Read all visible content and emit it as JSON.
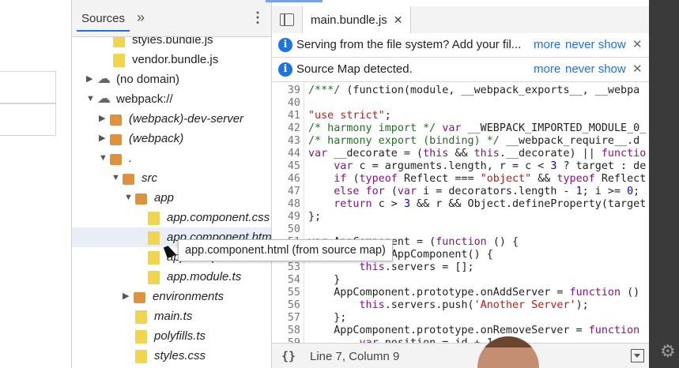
{
  "navigator": {
    "tab_label": "Sources",
    "more_tabs_icon": "»",
    "menu_icon": "⋮",
    "tree": [
      {
        "label": "styles.bundle.js",
        "kind": "file",
        "italic": false
      },
      {
        "label": "vendor.bundle.js",
        "kind": "file",
        "italic": false
      },
      {
        "label": "(no domain)",
        "kind": "cloud",
        "italic": false,
        "collapsed": true
      },
      {
        "label": "webpack://",
        "kind": "cloud",
        "italic": false,
        "collapsed": false
      },
      {
        "label": "(webpack)-dev-server",
        "kind": "folder",
        "italic": true,
        "collapsed": true
      },
      {
        "label": "(webpack)",
        "kind": "folder",
        "italic": true,
        "collapsed": true
      },
      {
        "label": ".",
        "kind": "folder",
        "italic": true,
        "collapsed": false
      },
      {
        "label": "src",
        "kind": "folder",
        "italic": true,
        "collapsed": false
      },
      {
        "label": "app",
        "kind": "folder",
        "italic": true,
        "collapsed": false
      },
      {
        "label": "app.component.css",
        "kind": "file",
        "italic": true
      },
      {
        "label": "app.component.html",
        "kind": "file",
        "italic": true,
        "selected": true
      },
      {
        "label": "app.component.ts",
        "kind": "file",
        "italic": true
      },
      {
        "label": "app.module.ts",
        "kind": "file",
        "italic": true
      },
      {
        "label": "environments",
        "kind": "folder",
        "italic": true,
        "collapsed": true
      },
      {
        "label": "main.ts",
        "kind": "file",
        "italic": true
      },
      {
        "label": "polyfills.ts",
        "kind": "file",
        "italic": true
      },
      {
        "label": "styles.css",
        "kind": "file",
        "italic": true
      }
    ]
  },
  "editor": {
    "open_tab": "main.bundle.js",
    "close_icon": "✕",
    "infobars": [
      {
        "message": "Serving from the file system? Add your fil...",
        "more": "more",
        "never_show": "never show",
        "close": "✕"
      },
      {
        "message": "Source Map detected.",
        "more": "more",
        "never_show": "never show",
        "close": "✕"
      }
    ],
    "code_lines": [
      {
        "n": "39",
        "parts": [
          [
            "cm",
            "/***/ "
          ],
          [
            "fn",
            "(function(module, __webpack_exports__, __webpa"
          ]
        ]
      },
      {
        "n": "40",
        "parts": []
      },
      {
        "n": "41",
        "parts": [
          [
            "st",
            "\"use strict\""
          ],
          [
            "fn",
            ";"
          ]
        ]
      },
      {
        "n": "42",
        "parts": [
          [
            "cm",
            "/* harmony import */ "
          ],
          [
            "kw",
            "var "
          ],
          [
            "fn",
            "__WEBPACK_IMPORTED_MODULE_0_"
          ]
        ]
      },
      {
        "n": "43",
        "parts": [
          [
            "cm",
            "/* harmony export (binding) */ "
          ],
          [
            "fn",
            "__webpack_require__.d"
          ]
        ]
      },
      {
        "n": "44",
        "parts": [
          [
            "kw",
            "var "
          ],
          [
            "fn",
            "__decorate = ("
          ],
          [
            "kw",
            "this "
          ],
          [
            "fn",
            "&& "
          ],
          [
            "kw",
            "this"
          ],
          [
            "fn",
            ".__decorate) || "
          ],
          [
            "kw",
            "functio"
          ]
        ]
      },
      {
        "n": "45",
        "parts": [
          [
            "fn",
            "    "
          ],
          [
            "kw",
            "var "
          ],
          [
            "fn",
            "c = arguments.length, r = c < "
          ],
          [
            "pl",
            "3"
          ],
          [
            "fn",
            " ? target : de"
          ]
        ]
      },
      {
        "n": "46",
        "parts": [
          [
            "fn",
            "    "
          ],
          [
            "kw",
            "if "
          ],
          [
            "fn",
            "("
          ],
          [
            "kw",
            "typeof "
          ],
          [
            "fn",
            "Reflect === "
          ],
          [
            "st",
            "\"object\""
          ],
          [
            "fn",
            " && "
          ],
          [
            "kw",
            "typeof "
          ],
          [
            "fn",
            "Reflect"
          ]
        ]
      },
      {
        "n": "47",
        "parts": [
          [
            "fn",
            "    "
          ],
          [
            "kw",
            "else for "
          ],
          [
            "fn",
            "("
          ],
          [
            "kw",
            "var "
          ],
          [
            "fn",
            "i = decorators.length - "
          ],
          [
            "pl",
            "1"
          ],
          [
            "fn",
            "; i >= "
          ],
          [
            "pl",
            "0"
          ],
          [
            "fn",
            ";"
          ]
        ]
      },
      {
        "n": "48",
        "parts": [
          [
            "fn",
            "    "
          ],
          [
            "kw",
            "return "
          ],
          [
            "fn",
            "c > "
          ],
          [
            "pl",
            "3"
          ],
          [
            "fn",
            " && r && Object.defineProperty(target"
          ]
        ]
      },
      {
        "n": "49",
        "parts": [
          [
            "fn",
            "};"
          ]
        ]
      },
      {
        "n": "50",
        "parts": []
      },
      {
        "n": "51",
        "parts": [
          [
            "fn",
            "var AppComponent = ("
          ],
          [
            "kw",
            "function "
          ],
          [
            "fn",
            "() {"
          ]
        ]
      },
      {
        "n": "52",
        "parts": [
          [
            "fn",
            "    "
          ],
          [
            "kw",
            "function "
          ],
          [
            "fn",
            "AppComponent() {"
          ]
        ]
      },
      {
        "n": "53",
        "parts": [
          [
            "fn",
            "        "
          ],
          [
            "kw",
            "this"
          ],
          [
            "fn",
            ".servers = [];"
          ]
        ]
      },
      {
        "n": "54",
        "parts": [
          [
            "fn",
            "    }"
          ]
        ]
      },
      {
        "n": "55",
        "parts": [
          [
            "fn",
            "    AppComponent.prototype.onAddServer = "
          ],
          [
            "kw",
            "function "
          ],
          [
            "fn",
            "()"
          ]
        ]
      },
      {
        "n": "56",
        "parts": [
          [
            "fn",
            "        "
          ],
          [
            "kw",
            "this"
          ],
          [
            "fn",
            ".servers.push("
          ],
          [
            "st",
            "'Another Server'"
          ],
          [
            "fn",
            ");"
          ]
        ]
      },
      {
        "n": "57",
        "parts": [
          [
            "fn",
            "    };"
          ]
        ]
      },
      {
        "n": "58",
        "parts": [
          [
            "fn",
            "    AppComponent.prototype.onRemoveServer = "
          ],
          [
            "kw",
            "function"
          ]
        ]
      },
      {
        "n": "59",
        "parts": [
          [
            "fn",
            "        "
          ],
          [
            "kw",
            "var "
          ],
          [
            "fn",
            "position = id + 1"
          ]
        ]
      }
    ],
    "status": {
      "braces": "{}",
      "cursor": "Line 7, Column 9"
    }
  },
  "tooltip": {
    "text": "app.component.html (from source map)"
  },
  "colors": {
    "accent": "#1a73e8",
    "folder": "#e0913a",
    "file": "#f1d54b",
    "keyword": "#881280",
    "comment": "#236e25",
    "string": "#c41a16",
    "number": "#1c00cf"
  }
}
